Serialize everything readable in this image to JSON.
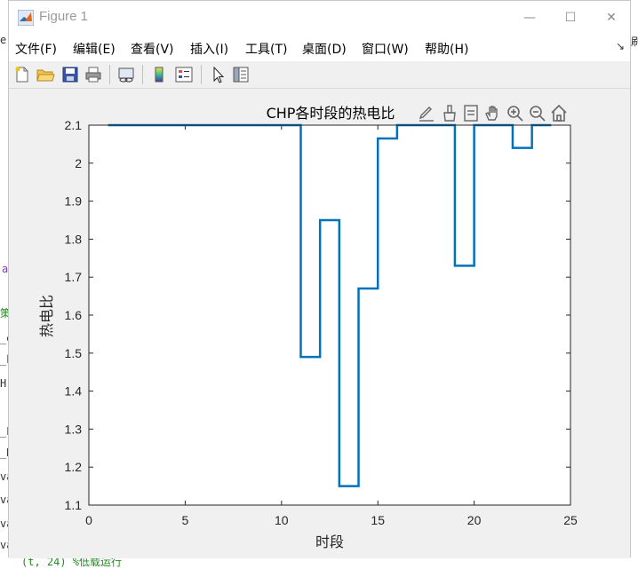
{
  "window": {
    "title": "Figure 1"
  },
  "controls": {
    "minimize": "—",
    "maximize": "☐",
    "close": "✕"
  },
  "menu": {
    "items": [
      "文件(F)",
      "编辑(E)",
      "查看(V)",
      "插入(I)",
      "工具(T)",
      "桌面(D)",
      "窗口(W)",
      "帮助(H)"
    ]
  },
  "toolbar": {
    "buttons": [
      "new-figure",
      "open-file",
      "save",
      "print",
      "link",
      "colorbar",
      "legend",
      "pointer",
      "property-inspector"
    ]
  },
  "axes_toolbar": {
    "buttons": [
      "edit-icon",
      "brush-icon",
      "datatip-icon",
      "pan-icon",
      "zoom-in-icon",
      "zoom-out-icon",
      "home-icon"
    ]
  },
  "chart_data": {
    "type": "line",
    "step": true,
    "title": "CHP各时段的热电比",
    "xlabel": "时段",
    "ylabel": "热电比",
    "xlim": [
      0,
      25
    ],
    "ylim": [
      1.1,
      2.1
    ],
    "xticks": [
      0,
      5,
      10,
      15,
      20,
      25
    ],
    "yticks": [
      1.1,
      1.2,
      1.3,
      1.4,
      1.5,
      1.6,
      1.7,
      1.8,
      1.9,
      2,
      2.1
    ],
    "grid": false,
    "series": [
      {
        "color": "#0072BD",
        "x": [
          1,
          2,
          3,
          4,
          5,
          6,
          7,
          8,
          9,
          10,
          11,
          12,
          13,
          14,
          15,
          16,
          17,
          18,
          19,
          20,
          21,
          22,
          23,
          24
        ],
        "values": [
          2.1,
          2.1,
          2.1,
          2.1,
          2.1,
          2.1,
          2.1,
          2.1,
          2.1,
          2.1,
          1.49,
          1.85,
          1.15,
          1.67,
          2.065,
          2.1,
          2.1,
          2.1,
          1.73,
          2.1,
          2.1,
          2.04,
          2.1,
          2.1
        ]
      }
    ]
  },
  "background": {
    "fragments": [
      "er",
      "刷",
      "a",
      "策",
      "_e",
      "_h",
      "H",
      "_E",
      "_H",
      "va",
      "va",
      "va",
      "va",
      "(t, 24) %低载运行"
    ]
  }
}
